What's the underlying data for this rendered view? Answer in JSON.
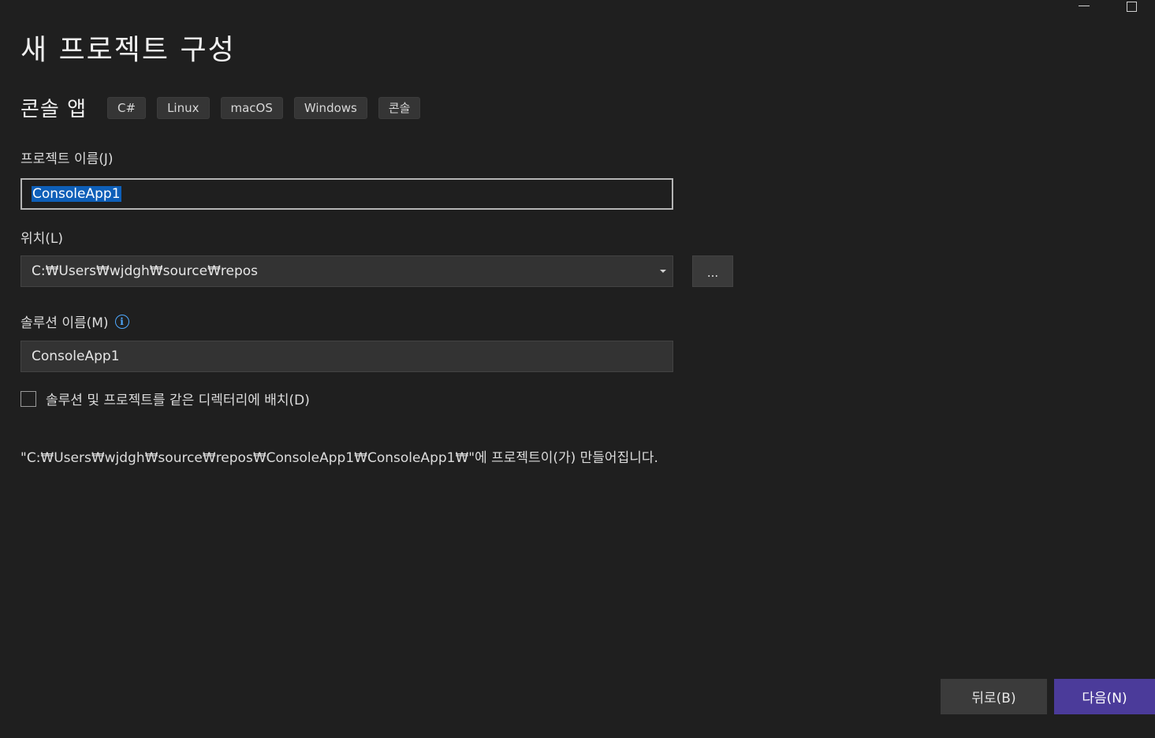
{
  "window": {
    "minimize_icon": "minimize-icon",
    "maximize_icon": "maximize-icon"
  },
  "header": {
    "title": "새 프로젝트 구성"
  },
  "template": {
    "name": "콘솔 앱",
    "tags": [
      "C#",
      "Linux",
      "macOS",
      "Windows",
      "콘솔"
    ]
  },
  "project_name": {
    "label": "프로젝트 이름(J)",
    "value": "ConsoleApp1"
  },
  "location": {
    "label": "위치(L)",
    "value": "C:₩Users₩wjdgh₩source₩repos",
    "browse_label": "..."
  },
  "solution_name": {
    "label": "솔루션 이름(M)",
    "value": "ConsoleApp1",
    "info_icon": "info-icon"
  },
  "same_directory": {
    "label": "솔루션 및 프로젝트를 같은 디렉터리에 배치(D)",
    "checked": false
  },
  "path_preview": "\"C:₩Users₩wjdgh₩source₩repos₩ConsoleApp1₩ConsoleApp1₩\"에 프로젝트이(가) 만들어집니다.",
  "footer": {
    "back_label": "뒤로(B)",
    "next_label": "다음(N)"
  },
  "colors": {
    "background": "#1f1f1f",
    "accent": "#4b3b9a",
    "selection": "#0e5fb8",
    "info": "#4ea9ff"
  }
}
